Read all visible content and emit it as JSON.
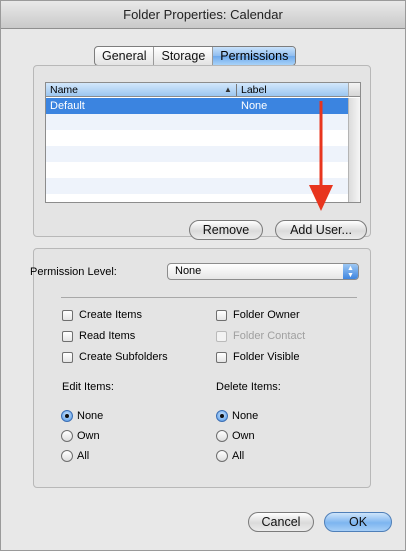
{
  "window": {
    "title": "Folder Properties: Calendar"
  },
  "tabs": [
    {
      "label": "General"
    },
    {
      "label": "Storage"
    },
    {
      "label": "Permissions",
      "active": true
    }
  ],
  "table": {
    "columns": [
      "Name",
      "Label"
    ],
    "rows": [
      {
        "name": "Default",
        "label": "None",
        "selected": true
      }
    ]
  },
  "buttons": {
    "remove": "Remove",
    "add_user": "Add User...",
    "cancel": "Cancel",
    "ok": "OK"
  },
  "permission_level": {
    "label": "Permission Level:",
    "value": "None"
  },
  "checkboxes": {
    "create_items": "Create Items",
    "read_items": "Read Items",
    "create_subfolders": "Create Subfolders",
    "folder_owner": "Folder Owner",
    "folder_contact": "Folder Contact",
    "folder_visible": "Folder Visible"
  },
  "edit_items": {
    "label": "Edit Items:",
    "options": [
      "None",
      "Own",
      "All"
    ],
    "selected": "None"
  },
  "delete_items": {
    "label": "Delete Items:",
    "options": [
      "None",
      "Own",
      "All"
    ],
    "selected": "None"
  },
  "colors": {
    "selection": "#3b84e0",
    "annotation_arrow": "#e8351e"
  }
}
